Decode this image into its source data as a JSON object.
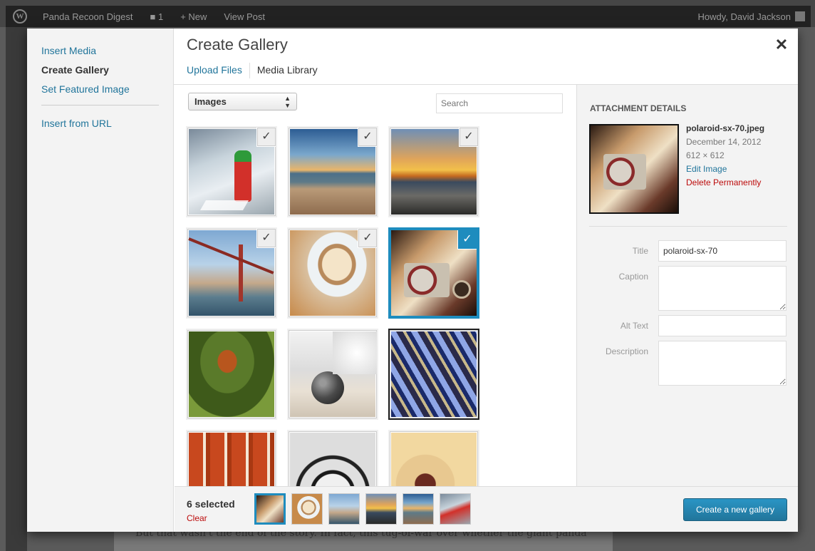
{
  "adminbar": {
    "site_name": "Panda Recoon Digest",
    "comments_count": "1",
    "new_label": "+ New",
    "view_post": "View Post",
    "howdy": "Howdy, David Jackson"
  },
  "background_text": "But that wasn't the end of the story. In fact, this tug-of-war over whether the giant panda",
  "menu": {
    "items": [
      {
        "label": "Insert Media"
      },
      {
        "label": "Create Gallery",
        "active": true
      },
      {
        "label": "Set Featured Image"
      },
      {
        "label": "Insert from URL"
      }
    ]
  },
  "modal": {
    "title": "Create Gallery",
    "close_icon": "close-icon",
    "routers": [
      {
        "label": "Upload Files"
      },
      {
        "label": "Media Library",
        "active": true
      }
    ]
  },
  "browser": {
    "filter_value": "Images",
    "search_placeholder": "Search",
    "attachments": [
      {
        "name": "sriracha",
        "selected": true
      },
      {
        "name": "beach",
        "selected": true
      },
      {
        "name": "sunset",
        "selected": true
      },
      {
        "name": "golden-gate",
        "selected": true
      },
      {
        "name": "coffee",
        "selected": true
      },
      {
        "name": "polaroid",
        "selected": true,
        "details": true
      },
      {
        "name": "red-panda",
        "selected": false
      },
      {
        "name": "ball",
        "selected": false
      },
      {
        "name": "glasses",
        "selected": false
      },
      {
        "name": "numbers",
        "selected": false
      },
      {
        "name": "meter",
        "selected": false
      },
      {
        "name": "headphones",
        "selected": false
      }
    ]
  },
  "details": {
    "heading": "Attachment Details",
    "filename": "polaroid-sx-70.jpeg",
    "date": "December 14, 2012",
    "dimensions": "612 × 612",
    "edit": "Edit Image",
    "delete": "Delete Permanently",
    "fields": {
      "title_label": "Title",
      "title_value": "polaroid-sx-70",
      "caption_label": "Caption",
      "alt_label": "Alt Text",
      "description_label": "Description"
    }
  },
  "selection": {
    "count_text": "6 selected",
    "clear": "Clear",
    "thumbs": [
      "polaroid",
      "coffee",
      "golden-gate",
      "sunset",
      "beach",
      "sriracha"
    ]
  },
  "primary_button": "Create a new gallery",
  "colors": {
    "accent": "#1e8cbe",
    "link": "#21759b",
    "danger": "#bc0b0b"
  }
}
